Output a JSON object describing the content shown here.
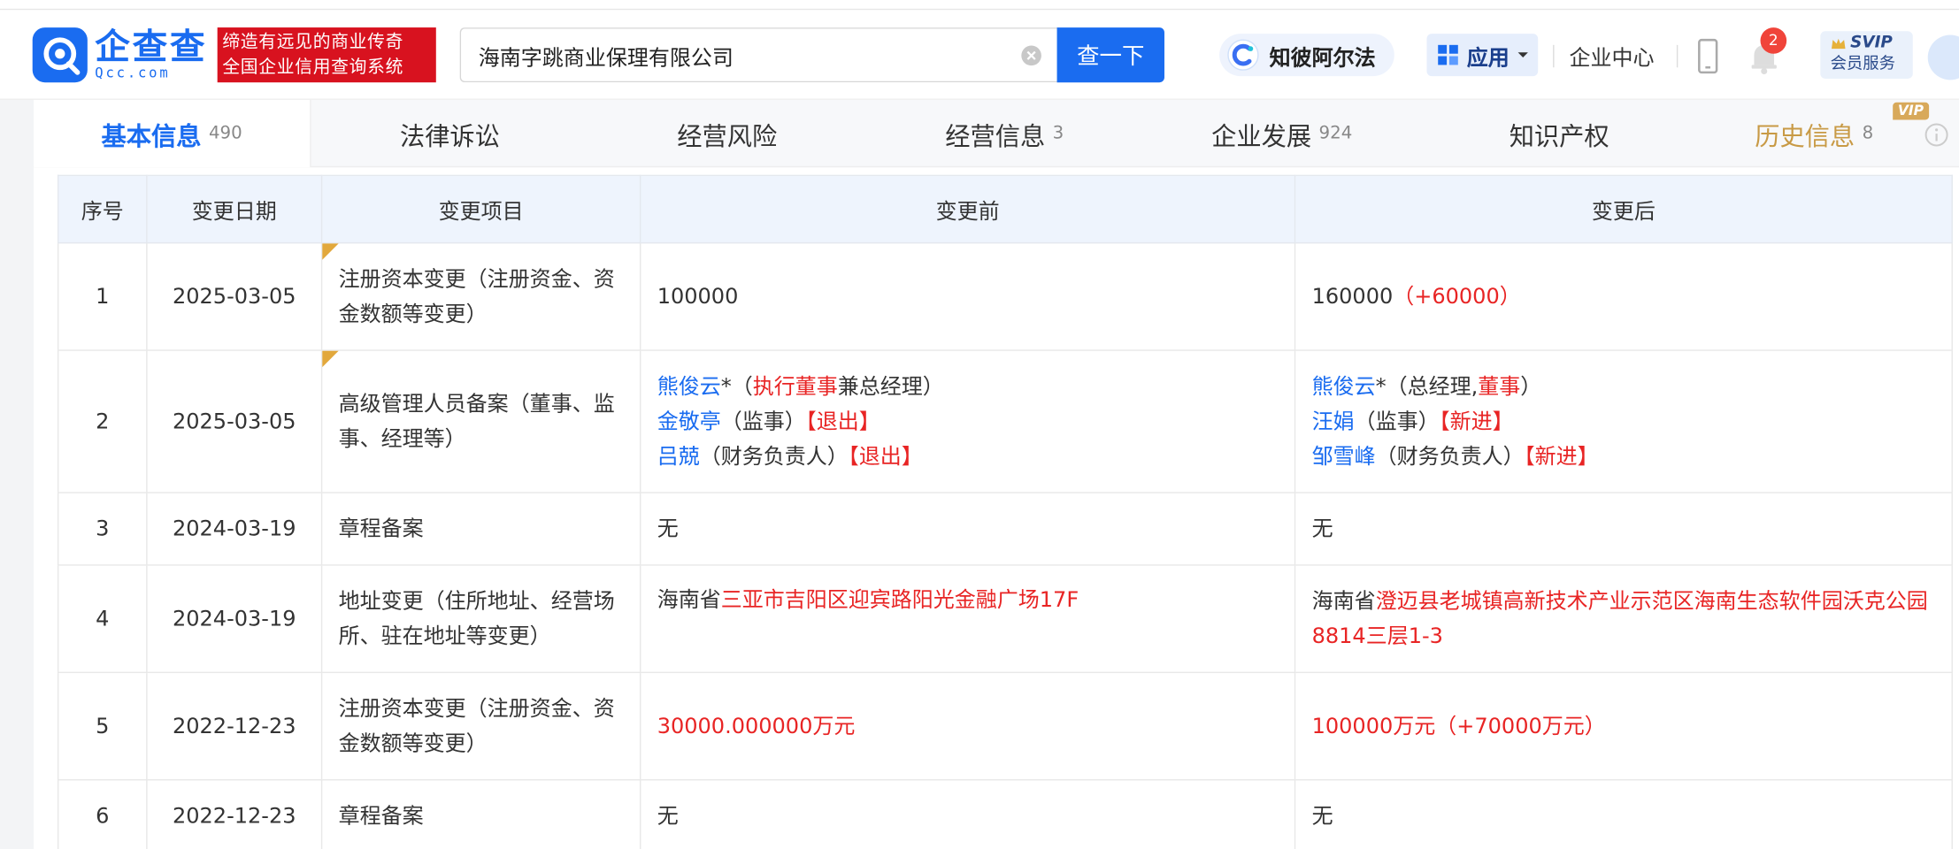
{
  "header": {
    "logo": {
      "cn": "企查查",
      "en": "Qcc.com"
    },
    "slogan": [
      "缔造有远见的商业传奇",
      "全国企业信用查询系统"
    ],
    "search": {
      "value": "海南字跳商业保理有限公司",
      "button": "查一下"
    },
    "alpha_label": "知彼阿尔法",
    "apps_label": "应用",
    "enterprise_center": "企业中心",
    "notification_count": "2",
    "svip": {
      "top": "SVIP",
      "bottom": "会员服务"
    }
  },
  "tabs": [
    {
      "label": "基本信息",
      "count": "490"
    },
    {
      "label": "法律诉讼",
      "count": ""
    },
    {
      "label": "经营风险",
      "count": ""
    },
    {
      "label": "经营信息",
      "count": "3"
    },
    {
      "label": "企业发展",
      "count": "924"
    },
    {
      "label": "知识产权",
      "count": ""
    },
    {
      "label": "历史信息",
      "count": "8",
      "tag": "VIP"
    }
  ],
  "table": {
    "headers": [
      "序号",
      "变更日期",
      "变更项目",
      "变更前",
      "变更后"
    ],
    "rows": [
      {
        "no": "1",
        "date": "2025-03-05",
        "item": "注册资本变更（注册资金、资金数额等变更）",
        "before": [
          {
            "text": "100000",
            "c": ""
          }
        ],
        "after": [
          {
            "text": "160000",
            "c": ""
          },
          {
            "text": "（+60000）",
            "c": "red"
          }
        ]
      },
      {
        "no": "2",
        "date": "2025-03-05",
        "item": "高级管理人员备案（董事、监事、经理等）",
        "before_lines": [
          [
            {
              "text": "熊俊云",
              "c": "blue"
            },
            {
              "text": "*（",
              "c": ""
            },
            {
              "text": "执行董事",
              "c": "red"
            },
            {
              "text": "兼总经理）",
              "c": ""
            }
          ],
          [
            {
              "text": "金敬亭",
              "c": "blue"
            },
            {
              "text": "（监事）",
              "c": ""
            },
            {
              "text": "【退出】",
              "c": "red"
            }
          ],
          [
            {
              "text": "吕兢",
              "c": "blue"
            },
            {
              "text": "（财务负责人）",
              "c": ""
            },
            {
              "text": "【退出】",
              "c": "red"
            }
          ]
        ],
        "after_lines": [
          [
            {
              "text": "熊俊云",
              "c": "blue"
            },
            {
              "text": "*（总经理,",
              "c": ""
            },
            {
              "text": "董事",
              "c": "red"
            },
            {
              "text": "）",
              "c": ""
            }
          ],
          [
            {
              "text": "汪娟",
              "c": "blue"
            },
            {
              "text": "（监事）",
              "c": ""
            },
            {
              "text": "【新进】",
              "c": "red"
            }
          ],
          [
            {
              "text": "邹雪峰",
              "c": "blue"
            },
            {
              "text": "（财务负责人）",
              "c": ""
            },
            {
              "text": "【新进】",
              "c": "red"
            }
          ]
        ]
      },
      {
        "no": "3",
        "date": "2024-03-19",
        "item": "章程备案",
        "before": [
          {
            "text": "无",
            "c": ""
          }
        ],
        "after": [
          {
            "text": "无",
            "c": ""
          }
        ]
      },
      {
        "no": "4",
        "date": "2024-03-19",
        "item": "地址变更（住所地址、经营场所、驻在地址等变更）",
        "before": [
          {
            "text": "海南省",
            "c": ""
          },
          {
            "text": "三亚市吉阳区迎宾路阳光金融广场17F",
            "c": "red"
          }
        ],
        "after": [
          {
            "text": "海南省",
            "c": ""
          },
          {
            "text": "澄迈县老城镇高新技术产业示范区海南生态软件园沃克公园8814三层1-3",
            "c": "red"
          }
        ]
      },
      {
        "no": "5",
        "date": "2022-12-23",
        "item": "注册资本变更（注册资金、资金数额等变更）",
        "before": [
          {
            "text": "30000.000000万元",
            "c": "red"
          }
        ],
        "after": [
          {
            "text": "100000万元",
            "c": "red"
          },
          {
            "text": "（+70000万元）",
            "c": "red"
          }
        ]
      },
      {
        "no": "6",
        "date": "2022-12-23",
        "item": "章程备案",
        "before": [
          {
            "text": "无",
            "c": ""
          }
        ],
        "after": [
          {
            "text": "无",
            "c": ""
          }
        ]
      }
    ]
  },
  "colors": {
    "brand": "#1a6cf0",
    "red": "#e82424",
    "slogan_bg": "#d8121f",
    "history": "#c89a45"
  }
}
